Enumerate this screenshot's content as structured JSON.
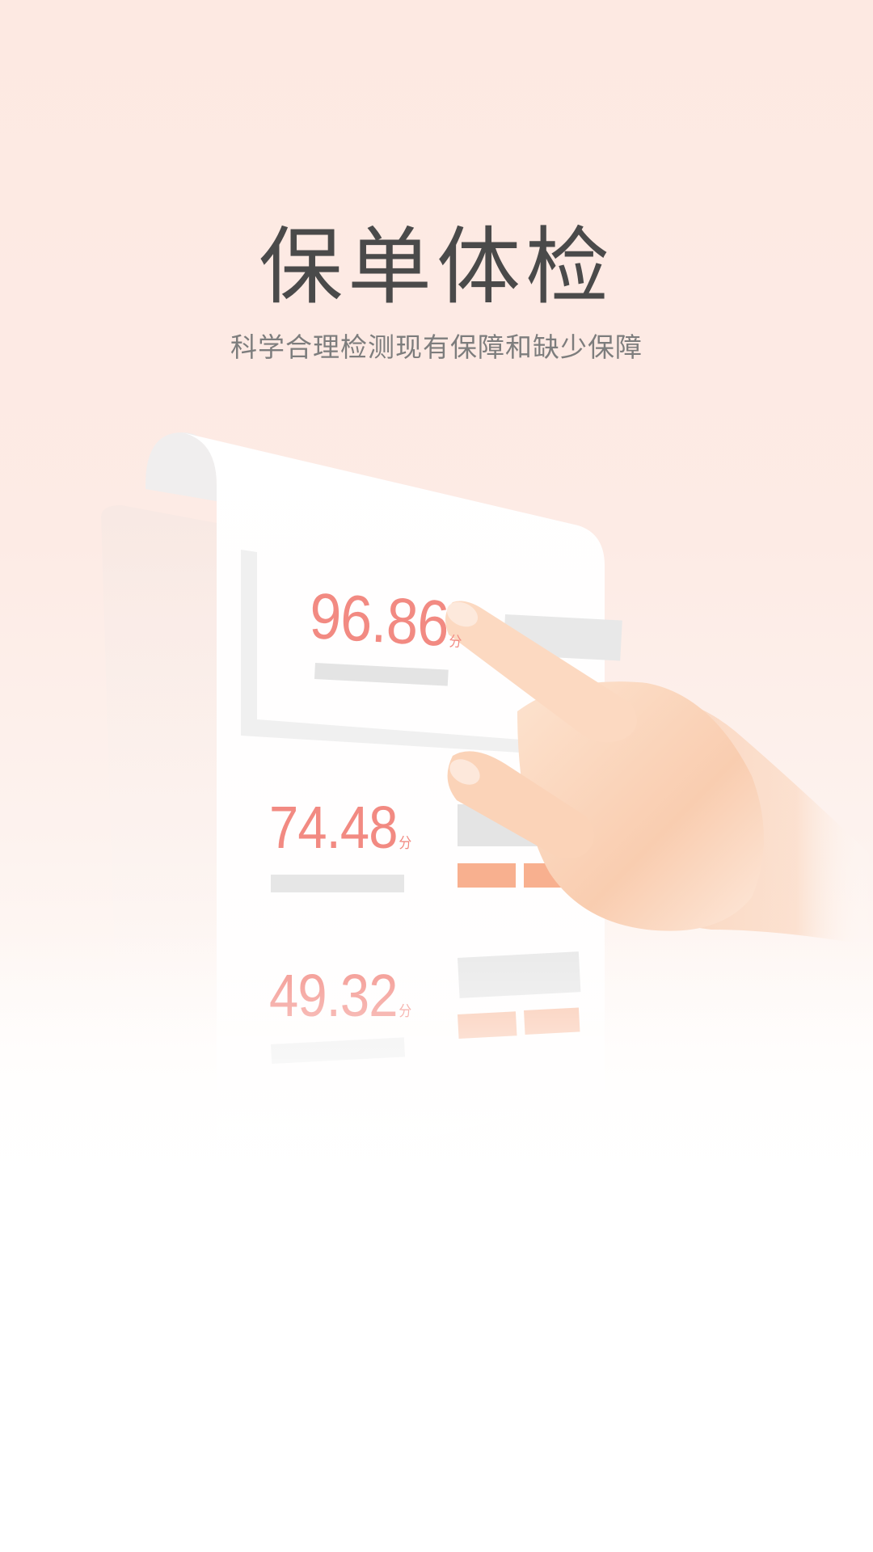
{
  "screen": {
    "title": "保单体检",
    "subtitle": "科学合理检测现有保障和缺少保障"
  },
  "scores": [
    {
      "value": "96.86",
      "unit": "分"
    },
    {
      "value": "74.48",
      "unit": "分"
    },
    {
      "value": "49.32",
      "unit": "分"
    }
  ],
  "colors": {
    "background_top": "#fde9e2",
    "title": "#4a4a4a",
    "subtitle": "#7d7d7d",
    "score": "#f28a82",
    "bar_accent": "#f8b08f",
    "bar_gray": "#e6e6e6"
  }
}
